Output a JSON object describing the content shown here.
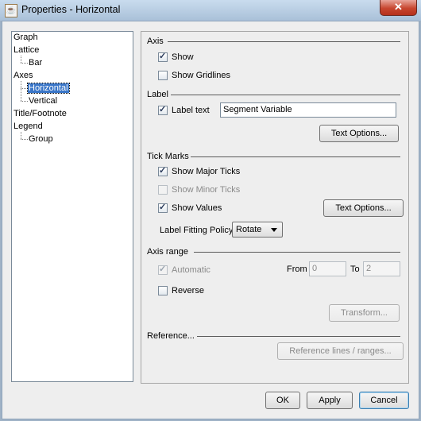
{
  "window": {
    "title": "Properties - Horizontal",
    "close_glyph": "✕",
    "app_icon": "java-cup-icon"
  },
  "tree": {
    "items": [
      {
        "label": "Graph"
      },
      {
        "label": "Lattice"
      },
      {
        "label": "Bar"
      },
      {
        "label": "Axes"
      },
      {
        "label": "Horizontal",
        "selected": true
      },
      {
        "label": "Vertical"
      },
      {
        "label": "Title/Footnote"
      },
      {
        "label": "Legend"
      },
      {
        "label": "Group"
      }
    ]
  },
  "axis": {
    "heading": "Axis",
    "show_label": "Show",
    "show_checked": true,
    "gridlines_label": "Show Gridlines",
    "gridlines_checked": false
  },
  "label": {
    "heading": "Label",
    "label_text_label": "Label text",
    "label_text_checked": true,
    "label_value": "Segment Variable",
    "text_options": "Text Options..."
  },
  "tick_marks": {
    "heading": "Tick Marks",
    "major_label": "Show Major Ticks",
    "major_checked": true,
    "minor_label": "Show Minor Ticks",
    "minor_checked": false,
    "values_label": "Show Values",
    "values_checked": true,
    "text_options": "Text Options...",
    "fitting_label": "Label Fitting Policy",
    "fitting_value": "Rotate"
  },
  "axis_range": {
    "heading": "Axis range",
    "automatic_label": "Automatic",
    "automatic_checked": true,
    "from_label": "From",
    "from_value": "0",
    "to_label": "To",
    "to_value": "2",
    "reverse_label": "Reverse",
    "reverse_checked": false,
    "transform": "Transform..."
  },
  "reference": {
    "heading": "Reference...",
    "button": "Reference lines / ranges..."
  },
  "footer": {
    "ok": "OK",
    "apply": "Apply",
    "cancel": "Cancel"
  }
}
